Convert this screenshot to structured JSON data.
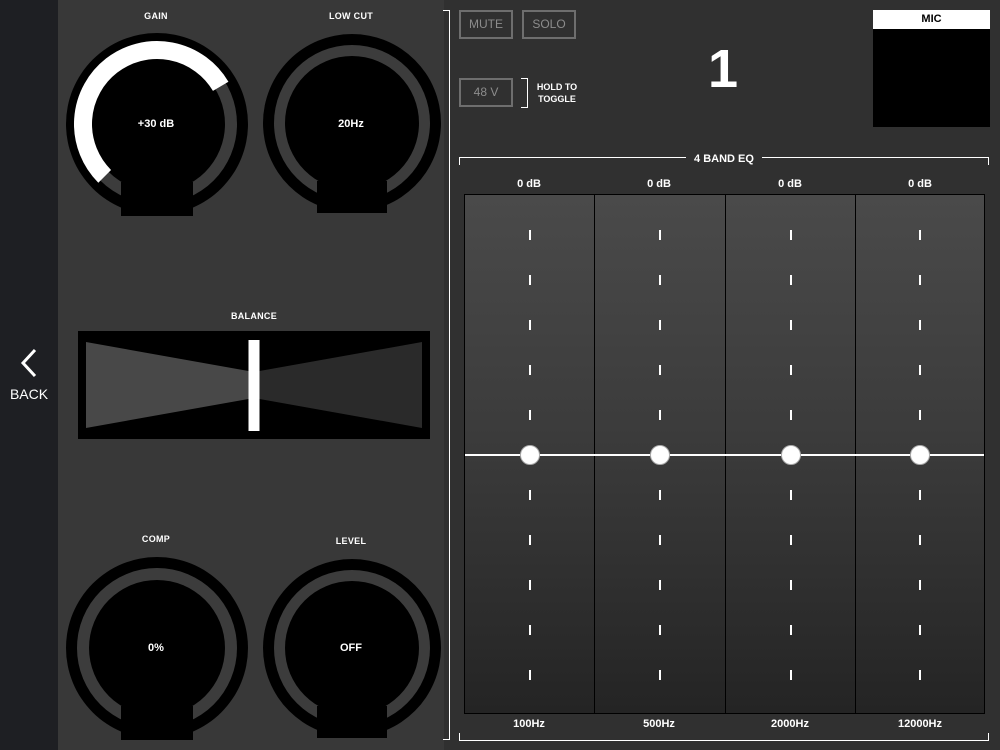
{
  "nav": {
    "back_label": "BACK"
  },
  "knobs": {
    "gain": {
      "label": "GAIN",
      "value": "+30 dB",
      "level": 0.72
    },
    "low_cut": {
      "label": "LOW CUT",
      "value": "20Hz",
      "level": 0
    },
    "comp": {
      "label": "COMP",
      "value": "0%",
      "level": 0
    },
    "level": {
      "label": "LEVEL",
      "value": "OFF",
      "level": 0
    }
  },
  "balance": {
    "label": "BALANCE",
    "position": 0.5
  },
  "buttons": {
    "mute": "MUTE",
    "solo": "SOLO",
    "phantom": "48 V",
    "hold_to_toggle": "HOLD TO TOGGLE"
  },
  "channel": {
    "number": "1",
    "input_label": "MIC"
  },
  "eq": {
    "title": "4 BAND EQ",
    "bands": [
      {
        "gain": "0 dB",
        "freq": "100Hz"
      },
      {
        "gain": "0 dB",
        "freq": "500Hz"
      },
      {
        "gain": "0 dB",
        "freq": "2000Hz"
      },
      {
        "gain": "0 dB",
        "freq": "12000Hz"
      }
    ]
  },
  "colors": {
    "background": "#303030",
    "panel": "#383838",
    "sidebar": "#1e1f23",
    "accent": "#ffffff"
  }
}
